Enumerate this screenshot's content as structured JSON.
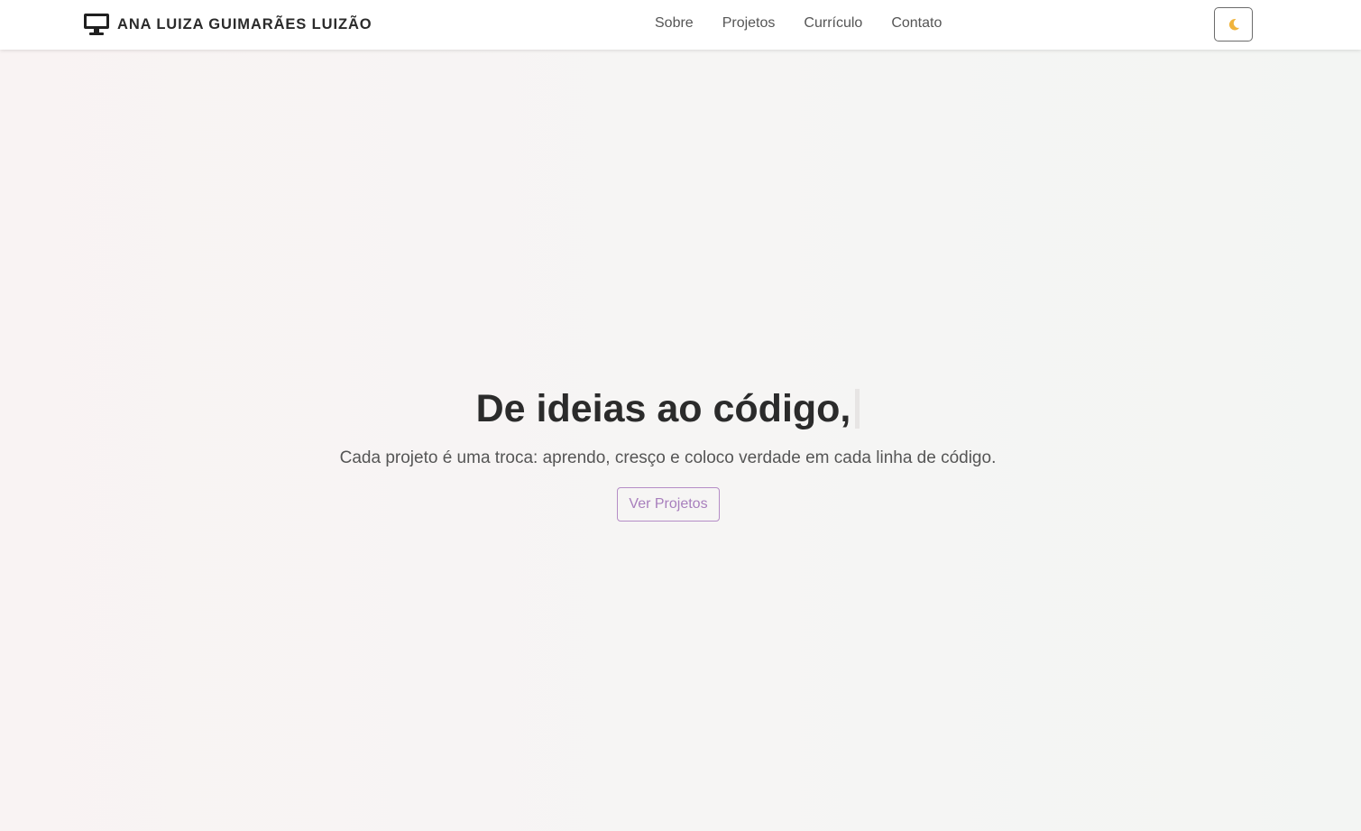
{
  "nav": {
    "brand_text": "ANA LUIZA GUIMARÃES LUIZÃO",
    "brand_icon": "monitor-icon",
    "links": [
      {
        "label": "Sobre"
      },
      {
        "label": "Projetos"
      },
      {
        "label": "Currículo"
      },
      {
        "label": "Contato"
      }
    ],
    "theme_toggle_icon": "moon-icon"
  },
  "hero": {
    "title": "De ideias ao código,",
    "subtitle": "Cada projeto é uma troca: aprendo, cresço e coloco verdade em cada linha de código.",
    "button_label": "Ver Projetos"
  },
  "colors": {
    "accent": "#a87fbd",
    "text_dark": "#2b2b2b",
    "text_muted": "#555555",
    "moon": "#f0b43c"
  }
}
